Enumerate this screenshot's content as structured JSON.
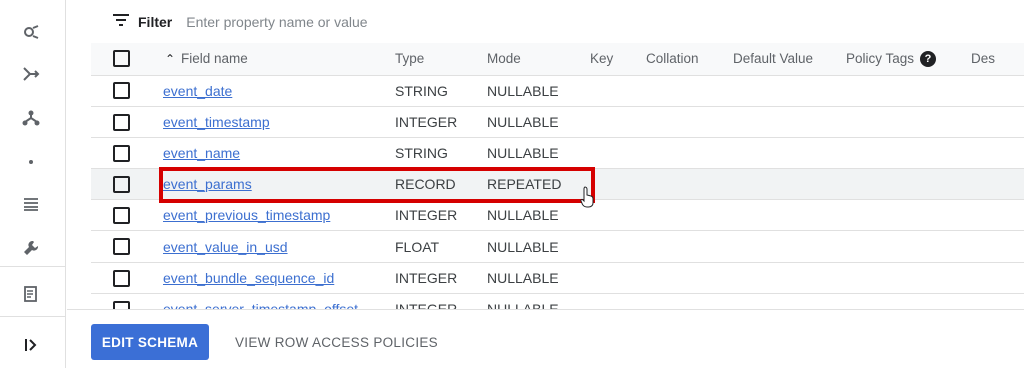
{
  "rail": {
    "icons": [
      "explore-icon",
      "pipeline-icon",
      "hierarchy-icon",
      "dot-icon",
      "list-icon",
      "wrench-icon",
      "notes-icon"
    ],
    "collapse_icon": "expand-panel-icon"
  },
  "filter": {
    "label": "Filter",
    "placeholder": "Enter property name or value"
  },
  "table": {
    "headers": {
      "field_name": "Field name",
      "type": "Type",
      "mode": "Mode",
      "key": "Key",
      "collation": "Collation",
      "default_value": "Default Value",
      "policy_tags": "Policy Tags",
      "description": "Des"
    },
    "rows": [
      {
        "name": "event_date",
        "type": "STRING",
        "mode": "NULLABLE"
      },
      {
        "name": "event_timestamp",
        "type": "INTEGER",
        "mode": "NULLABLE"
      },
      {
        "name": "event_name",
        "type": "STRING",
        "mode": "NULLABLE"
      },
      {
        "name": "event_params",
        "type": "RECORD",
        "mode": "REPEATED"
      },
      {
        "name": "event_previous_timestamp",
        "type": "INTEGER",
        "mode": "NULLABLE"
      },
      {
        "name": "event_value_in_usd",
        "type": "FLOAT",
        "mode": "NULLABLE"
      },
      {
        "name": "event_bundle_sequence_id",
        "type": "INTEGER",
        "mode": "NULLABLE"
      },
      {
        "name": "event_server_timestamp_offset",
        "type": "INTEGER",
        "mode": "NULLABLE"
      }
    ]
  },
  "actions": {
    "edit_schema": "EDIT SCHEMA",
    "view_row_access": "VIEW ROW ACCESS POLICIES"
  },
  "colors": {
    "primary": "#3b6fd6",
    "link": "#3c6fd0",
    "highlight": "#d50000"
  }
}
